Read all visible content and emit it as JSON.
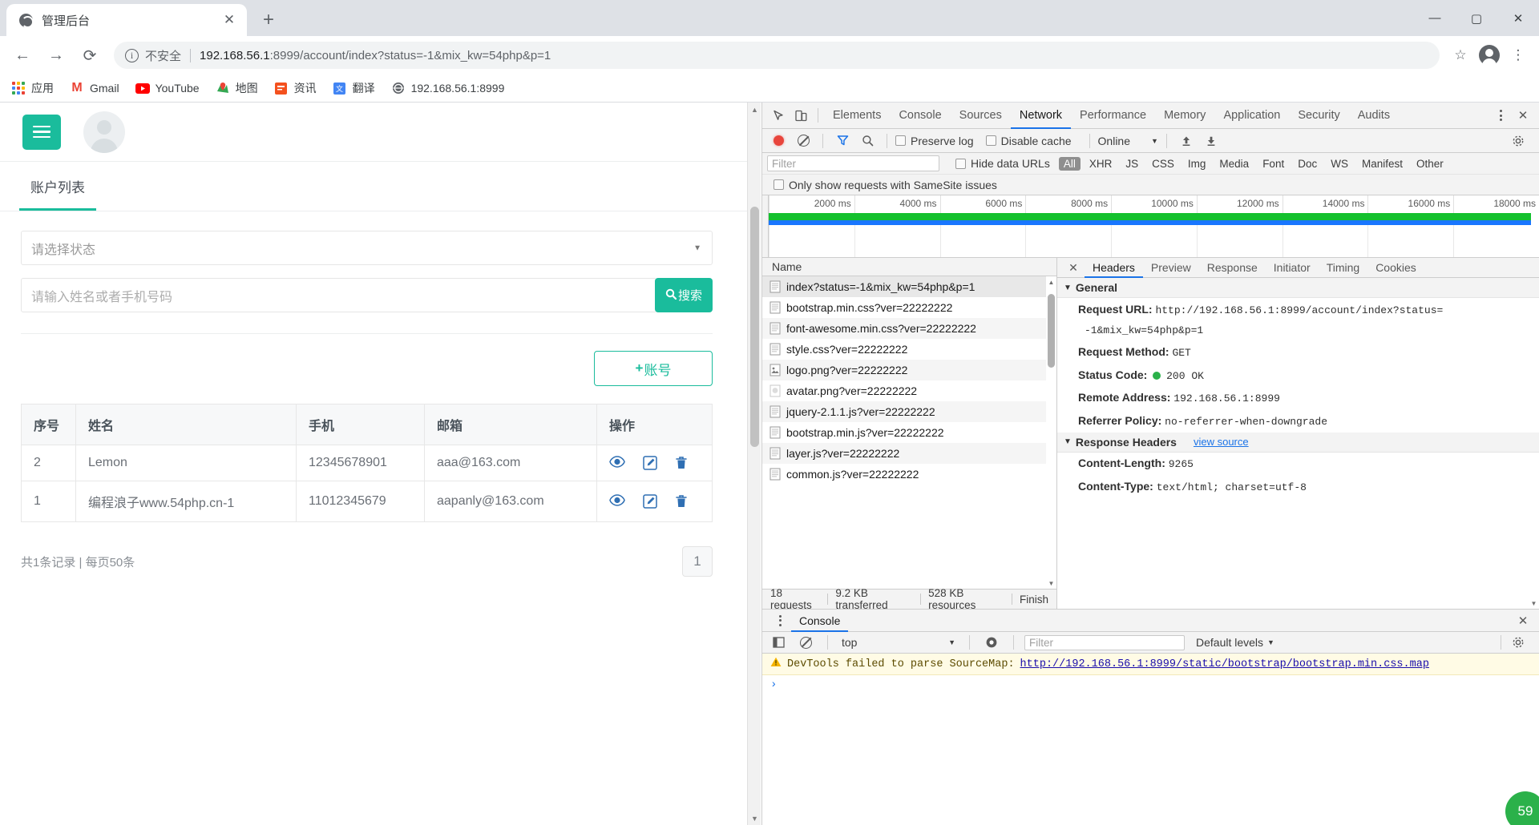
{
  "browser": {
    "tab": {
      "title": "管理后台",
      "favicon": "globe-icon",
      "close": "✕"
    },
    "new_tab_label": "+",
    "window_controls": {
      "minimize": "—",
      "maximize": "▢",
      "close": "✕"
    },
    "nav": {
      "back": "←",
      "forward": "→",
      "reload": "⟳"
    },
    "omnibox": {
      "info_icon": "info-icon",
      "security_label": "不安全",
      "url_host": "192.168.56.1",
      "url_rest": ":8999/account/index?status=-1&mix_kw=54php&p=1"
    },
    "toolbar_right": {
      "bookmark": "☆",
      "profile": "avatar-icon",
      "menu": "⋮"
    },
    "bookmarks": [
      {
        "label": "应用",
        "icon": "apps-grid-icon"
      },
      {
        "label": "Gmail",
        "icon": "gmail-icon"
      },
      {
        "label": "YouTube",
        "icon": "youtube-icon"
      },
      {
        "label": "地图",
        "icon": "maps-icon"
      },
      {
        "label": "资讯",
        "icon": "news-icon"
      },
      {
        "label": "翻译",
        "icon": "translate-icon"
      },
      {
        "label": "192.168.56.1:8999",
        "icon": "globe-icon"
      }
    ]
  },
  "page": {
    "menu_button": "hamburger-icon",
    "avatar": "user-avatar-icon",
    "tab_label": "账户列表",
    "status_select": {
      "value": "请选择状态",
      "caret": "▼"
    },
    "search": {
      "placeholder": "请输入姓名或者手机号码",
      "button_label": "搜索",
      "button_icon": "search-icon"
    },
    "add_button": {
      "plus": "+",
      "label": "账号"
    },
    "table": {
      "columns": [
        "序号",
        "姓名",
        "手机",
        "邮箱",
        "操作"
      ],
      "rows": [
        {
          "id": "2",
          "name": "Lemon",
          "phone": "12345678901",
          "email": "aaa@163.com",
          "actions": [
            "eye-icon",
            "edit-icon",
            "trash-icon"
          ]
        },
        {
          "id": "1",
          "name": "编程浪子www.54php.cn-1",
          "phone": "11012345679",
          "email": "aapanly@163.com",
          "actions": [
            "eye-icon",
            "edit-icon",
            "trash-icon"
          ]
        }
      ]
    },
    "record_summary": "共1条记录 | 每页50条",
    "pagination": {
      "current": "1"
    },
    "scroll": {
      "up": "▲",
      "down": "▼"
    }
  },
  "devtools": {
    "tabs": [
      {
        "label": "Elements",
        "active": false
      },
      {
        "label": "Console",
        "active": false
      },
      {
        "label": "Sources",
        "active": false
      },
      {
        "label": "Network",
        "active": true
      },
      {
        "label": "Performance",
        "active": false
      },
      {
        "label": "Memory",
        "active": false
      },
      {
        "label": "Application",
        "active": false
      },
      {
        "label": "Security",
        "active": false
      },
      {
        "label": "Audits",
        "active": false
      }
    ],
    "left_icons": [
      "inspect-icon",
      "device-toolbar-icon"
    ],
    "right_icons": [
      "more-options-icon",
      "close-icon"
    ],
    "network_toolbar": {
      "record_icon": "record-stop-icon",
      "clear_icon": "clear-icon",
      "filter_icon": "funnel-icon",
      "search_icon": "search-icon",
      "preserve_log": "Preserve log",
      "disable_cache": "Disable cache",
      "throttle_value": "Online",
      "throttle_caret": "▼",
      "import_icon": "import-har-icon",
      "export_icon": "export-har-icon",
      "settings_icon": "gear-icon"
    },
    "filter_bar": {
      "filter_placeholder": "Filter",
      "hide_data_urls": "Hide data URLs",
      "types": [
        "All",
        "XHR",
        "JS",
        "CSS",
        "Img",
        "Media",
        "Font",
        "Doc",
        "WS",
        "Manifest",
        "Other"
      ],
      "active_type": "All"
    },
    "samesite_label": "Only show requests with SameSite issues",
    "timeline": {
      "ticks": [
        "2000 ms",
        "4000 ms",
        "6000 ms",
        "8000 ms",
        "10000 ms",
        "12000 ms",
        "14000 ms",
        "16000 ms",
        "18000 ms"
      ]
    },
    "requests": {
      "header": "Name",
      "items": [
        {
          "name": "index?status=-1&mix_kw=54php&p=1",
          "icon": "document-icon",
          "selected": true
        },
        {
          "name": "bootstrap.min.css?ver=22222222",
          "icon": "stylesheet-icon",
          "selected": false
        },
        {
          "name": "font-awesome.min.css?ver=22222222",
          "icon": "stylesheet-icon",
          "selected": false
        },
        {
          "name": "style.css?ver=22222222",
          "icon": "stylesheet-icon",
          "selected": false
        },
        {
          "name": "logo.png?ver=22222222",
          "icon": "image-icon",
          "selected": false
        },
        {
          "name": "avatar.png?ver=22222222",
          "icon": "image-icon",
          "selected": false
        },
        {
          "name": "jquery-2.1.1.js?ver=22222222",
          "icon": "script-icon",
          "selected": false
        },
        {
          "name": "bootstrap.min.js?ver=22222222",
          "icon": "script-icon",
          "selected": false
        },
        {
          "name": "layer.js?ver=22222222",
          "icon": "script-icon",
          "selected": false
        },
        {
          "name": "common.js?ver=22222222",
          "icon": "script-icon",
          "selected": false
        }
      ],
      "status": {
        "requests": "18 requests",
        "transferred": "9.2 KB transferred",
        "resources": "528 KB resources",
        "finish": "Finish"
      }
    },
    "details": {
      "tabs": [
        {
          "label": "Headers",
          "active": true
        },
        {
          "label": "Preview",
          "active": false
        },
        {
          "label": "Response",
          "active": false
        },
        {
          "label": "Initiator",
          "active": false
        },
        {
          "label": "Timing",
          "active": false
        },
        {
          "label": "Cookies",
          "active": false
        }
      ],
      "close_icon": "close-icon",
      "general": {
        "title": "General",
        "caret": "▼",
        "rows": [
          {
            "key": "Request URL:",
            "value": "http://192.168.56.1:8999/account/index?status="
          },
          {
            "key": "",
            "value": "-1&mix_kw=54php&p=1"
          },
          {
            "key": "Request Method:",
            "value": "GET"
          },
          {
            "key": "Status Code:",
            "value": "200 OK",
            "status_dot": true
          },
          {
            "key": "Remote Address:",
            "value": "192.168.56.1:8999"
          },
          {
            "key": "Referrer Policy:",
            "value": "no-referrer-when-downgrade"
          }
        ]
      },
      "response_headers": {
        "title": "Response Headers",
        "caret": "▼",
        "view_source": "view source",
        "rows": [
          {
            "key": "Content-Length:",
            "value": "9265"
          },
          {
            "key": "Content-Type:",
            "value": "text/html; charset=utf-8"
          }
        ]
      }
    },
    "console_drawer": {
      "tab_label": "Console",
      "kebab_icon": "more-tabs-icon",
      "close_icon": "close-icon",
      "sidebar_icon": "show-sidebar-icon",
      "clear_icon": "clear-console-icon",
      "context": "top",
      "context_caret": "▼",
      "eye_icon": "live-expression-icon",
      "filter_placeholder": "Filter",
      "levels": "Default levels",
      "levels_caret": "▼",
      "settings_icon": "gear-icon",
      "messages": [
        {
          "icon": "warning-icon",
          "text": "DevTools failed to parse SourceMap:",
          "link": "http://192.168.56.1:8999/static/bootstrap/bootstrap.min.css.map"
        }
      ],
      "prompt": "›"
    }
  },
  "overlay": {
    "badge": "59"
  },
  "colors": {
    "accent_green": "#1abc9c",
    "devtools_blue": "#1a73e8",
    "action_blue": "#2f6fb3",
    "status_ok": "#2bb14a"
  }
}
